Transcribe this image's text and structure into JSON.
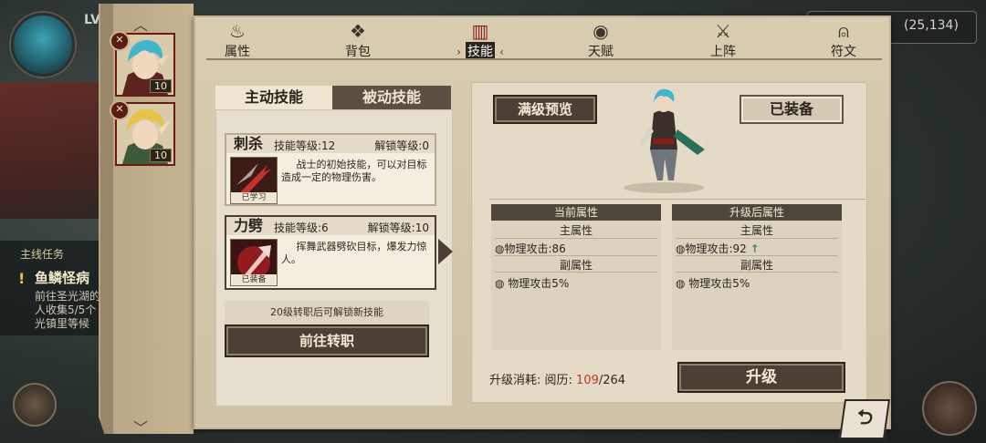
{
  "coordinates": "(25,134)",
  "background": {
    "level_prefix": "LV",
    "quest": {
      "section_title": "主线任务",
      "name": "鱼鳞怪病",
      "desc": "前往圣光湖的人收集5/5个光镇里等候"
    }
  },
  "characters": [
    {
      "level": "10",
      "hair": "#3fb6c9",
      "badge": "✕"
    },
    {
      "level": "10",
      "hair": "#e8c34a",
      "badge": "✕"
    }
  ],
  "tabs": [
    {
      "label": "属性",
      "icon": "flame-icon",
      "glyph": "♨"
    },
    {
      "label": "背包",
      "icon": "bag-icon",
      "glyph": "❖"
    },
    {
      "label": "技能",
      "icon": "book-icon",
      "glyph": "▥"
    },
    {
      "label": "天赋",
      "icon": "eye-icon",
      "glyph": "◉"
    },
    {
      "label": "上阵",
      "icon": "crossed-swords-icon",
      "glyph": "⚔"
    },
    {
      "label": "符文",
      "icon": "rune-icon",
      "glyph": "⍝"
    }
  ],
  "active_tab": "技能",
  "skill_tabs": {
    "active": "主动技能",
    "passive": "被动技能"
  },
  "skills": [
    {
      "name": "刺杀",
      "level_text": "技能等级:12",
      "unlock_text": "解锁等级:0",
      "desc": "战士的初始技能，可以对目标造成一定的物理伤害。",
      "state": "已学习"
    },
    {
      "name": "力劈",
      "level_text": "技能等级:6",
      "unlock_text": "解锁等级:10",
      "desc": "挥舞武器劈砍目标，爆发力惊人。",
      "state": "已装备"
    }
  ],
  "unlock_hint": "20级转职后可解锁新技能",
  "advance_button": "前往转职",
  "detail": {
    "preview_button": "满级预览",
    "equipped_button": "已装备",
    "current": {
      "header": "当前属性",
      "main_title": "主属性",
      "main_value": "物理攻击:86",
      "sub_title": "副属性",
      "sub_value": "物理攻击5%"
    },
    "after": {
      "header": "升级后属性",
      "main_title": "主属性",
      "main_value": "物理攻击:92",
      "sub_title": "副属性",
      "sub_value": "物理攻击5%"
    },
    "cost_label": "升级消耗: 阅历:",
    "cost_current": "109",
    "cost_sep": "/",
    "cost_required": "264",
    "upgrade_button": "升级"
  },
  "colors": {
    "accent_red": "#8b1c1c",
    "cost_red": "#c4371f",
    "up_arrow": "#3c8a4a"
  }
}
